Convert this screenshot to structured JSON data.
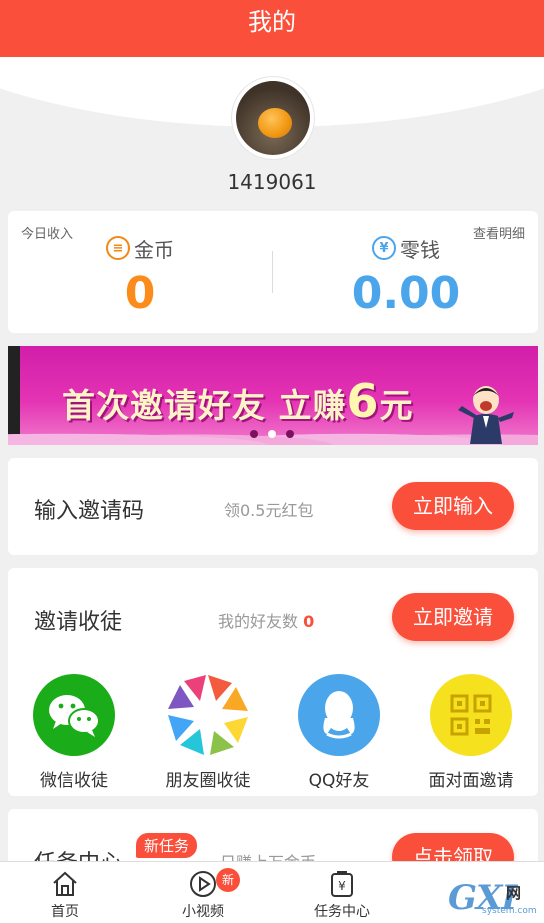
{
  "header": {
    "title": "我的"
  },
  "profile": {
    "user_id": "1419061"
  },
  "earnings": {
    "today_label": "今日收入",
    "details_link": "查看明细",
    "coins": {
      "label": "金币",
      "value": "0",
      "icon": "coin-icon",
      "color": "#fb8b1a"
    },
    "cash": {
      "label": "零钱",
      "value": "0.00",
      "icon": "yen-icon",
      "color": "#4aa5ea"
    }
  },
  "banner": {
    "text_main": "首次邀请好友 立赚",
    "text_amount": "6",
    "text_unit": "元",
    "slides_total": 3,
    "slide_active": 2
  },
  "invite_code": {
    "title": "输入邀请码",
    "subtitle": "领0.5元红包",
    "button": "立即输入"
  },
  "invite": {
    "title": "邀请收徒",
    "friends_label": "我的好友数",
    "friends_count": "0",
    "button": "立即邀请",
    "share_options": [
      {
        "label": "微信收徒",
        "icon": "wechat-icon",
        "color": "#1aad19"
      },
      {
        "label": "朋友圈收徒",
        "icon": "moments-icon",
        "color": "#ffffff"
      },
      {
        "label": "QQ好友",
        "icon": "qq-icon",
        "color": "#4aa5ea"
      },
      {
        "label": "面对面邀请",
        "icon": "qrcode-icon",
        "color": "#f5e11e"
      }
    ]
  },
  "task": {
    "title": "任务中心",
    "badge": "新任务",
    "subtitle": "日赚上万金币",
    "button": "点击领取"
  },
  "nav": {
    "items": [
      {
        "label": "首页",
        "icon": "home-icon"
      },
      {
        "label": "小视频",
        "icon": "play-icon",
        "badge": "新"
      },
      {
        "label": "任务中心",
        "icon": "task-icon"
      }
    ]
  },
  "watermark": {
    "big": "GXI",
    "cn": "网",
    "small": "system.com"
  },
  "colors": {
    "accent": "#fa4f3a",
    "coin": "#fb8b1a",
    "cash": "#4aa5ea"
  }
}
